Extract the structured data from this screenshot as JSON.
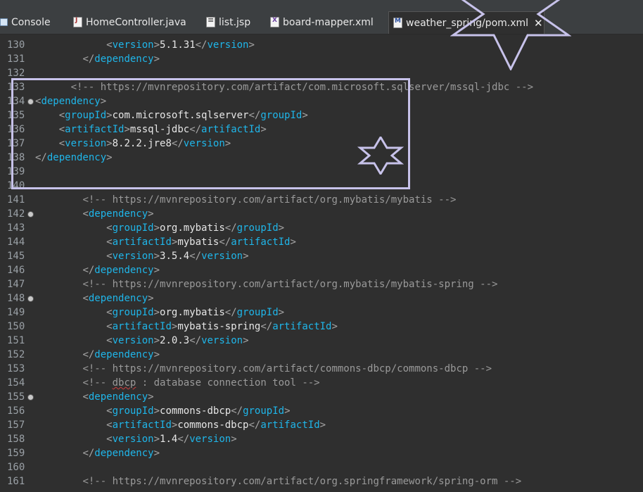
{
  "tabs": [
    {
      "label": "Console",
      "icon": "console-icon",
      "active": false
    },
    {
      "label": "HomeController.java",
      "icon": "java-file-icon",
      "active": false
    },
    {
      "label": "list.jsp",
      "icon": "jsp-file-icon",
      "active": false
    },
    {
      "label": "board-mapper.xml",
      "icon": "xml-file-icon",
      "active": false
    },
    {
      "label": "weather_spring/pom.xml",
      "icon": "maven-pom-icon",
      "active": true,
      "close": "✕"
    }
  ],
  "editor": {
    "lines": [
      {
        "num": "130",
        "indent": "            ",
        "content": [
          [
            "br",
            "<"
          ],
          [
            "tag",
            "version"
          ],
          [
            "br",
            ">"
          ],
          [
            "text",
            "5.1.31"
          ],
          [
            "br",
            "</"
          ],
          [
            "tag",
            "version"
          ],
          [
            "br",
            ">"
          ]
        ]
      },
      {
        "num": "131",
        "indent": "        ",
        "content": [
          [
            "br",
            "</"
          ],
          [
            "tag",
            "dependency"
          ],
          [
            "br",
            ">"
          ]
        ]
      },
      {
        "num": "132",
        "indent": "",
        "content": []
      },
      {
        "num": "133",
        "indent": "      ",
        "content": [
          [
            "comment",
            "<!-- https://mvnrepository.com/artifact/com.microsoft.sqlserver/mssql-jdbc -->"
          ]
        ]
      },
      {
        "num": "134",
        "indent": "",
        "fold": true,
        "content": [
          [
            "br",
            "<"
          ],
          [
            "tag",
            "dependency"
          ],
          [
            "br",
            ">"
          ]
        ]
      },
      {
        "num": "135",
        "indent": "    ",
        "content": [
          [
            "br",
            "<"
          ],
          [
            "tag",
            "groupId"
          ],
          [
            "br",
            ">"
          ],
          [
            "text",
            "com.microsoft.sqlserver"
          ],
          [
            "br",
            "</"
          ],
          [
            "tag",
            "groupId"
          ],
          [
            "br",
            ">"
          ]
        ]
      },
      {
        "num": "136",
        "indent": "    ",
        "content": [
          [
            "br",
            "<"
          ],
          [
            "tag",
            "artifactId"
          ],
          [
            "br",
            ">"
          ],
          [
            "text",
            "mssql-jdbc"
          ],
          [
            "br",
            "</"
          ],
          [
            "tag",
            "artifactId"
          ],
          [
            "br",
            ">"
          ]
        ]
      },
      {
        "num": "137",
        "indent": "    ",
        "content": [
          [
            "br",
            "<"
          ],
          [
            "tag",
            "version"
          ],
          [
            "br",
            ">"
          ],
          [
            "text",
            "8.2.2.jre8"
          ],
          [
            "br",
            "</"
          ],
          [
            "tag",
            "version"
          ],
          [
            "br",
            ">"
          ]
        ]
      },
      {
        "num": "138",
        "indent": "",
        "content": [
          [
            "br",
            "</"
          ],
          [
            "tag",
            "dependency"
          ],
          [
            "br",
            ">"
          ]
        ]
      },
      {
        "num": "139",
        "indent": "",
        "content": []
      },
      {
        "num": "140",
        "indent": "",
        "content": []
      },
      {
        "num": "141",
        "indent": "        ",
        "content": [
          [
            "comment",
            "<!-- https://mvnrepository.com/artifact/org.mybatis/mybatis -->"
          ]
        ]
      },
      {
        "num": "142",
        "indent": "        ",
        "fold": true,
        "content": [
          [
            "br",
            "<"
          ],
          [
            "tag",
            "dependency"
          ],
          [
            "br",
            ">"
          ]
        ]
      },
      {
        "num": "143",
        "indent": "            ",
        "content": [
          [
            "br",
            "<"
          ],
          [
            "tag",
            "groupId"
          ],
          [
            "br",
            ">"
          ],
          [
            "text",
            "org.mybatis"
          ],
          [
            "br",
            "</"
          ],
          [
            "tag",
            "groupId"
          ],
          [
            "br",
            ">"
          ]
        ]
      },
      {
        "num": "144",
        "indent": "            ",
        "content": [
          [
            "br",
            "<"
          ],
          [
            "tag",
            "artifactId"
          ],
          [
            "br",
            ">"
          ],
          [
            "text",
            "mybatis"
          ],
          [
            "br",
            "</"
          ],
          [
            "tag",
            "artifactId"
          ],
          [
            "br",
            ">"
          ]
        ]
      },
      {
        "num": "145",
        "indent": "            ",
        "content": [
          [
            "br",
            "<"
          ],
          [
            "tag",
            "version"
          ],
          [
            "br",
            ">"
          ],
          [
            "text",
            "3.5.4"
          ],
          [
            "br",
            "</"
          ],
          [
            "tag",
            "version"
          ],
          [
            "br",
            ">"
          ]
        ]
      },
      {
        "num": "146",
        "indent": "        ",
        "content": [
          [
            "br",
            "</"
          ],
          [
            "tag",
            "dependency"
          ],
          [
            "br",
            ">"
          ]
        ]
      },
      {
        "num": "147",
        "indent": "        ",
        "content": [
          [
            "comment",
            "<!-- https://mvnrepository.com/artifact/org.mybatis/mybatis-spring -->"
          ]
        ]
      },
      {
        "num": "148",
        "indent": "        ",
        "fold": true,
        "content": [
          [
            "br",
            "<"
          ],
          [
            "tag",
            "dependency"
          ],
          [
            "br",
            ">"
          ]
        ]
      },
      {
        "num": "149",
        "indent": "            ",
        "content": [
          [
            "br",
            "<"
          ],
          [
            "tag",
            "groupId"
          ],
          [
            "br",
            ">"
          ],
          [
            "text",
            "org.mybatis"
          ],
          [
            "br",
            "</"
          ],
          [
            "tag",
            "groupId"
          ],
          [
            "br",
            ">"
          ]
        ]
      },
      {
        "num": "150",
        "indent": "            ",
        "content": [
          [
            "br",
            "<"
          ],
          [
            "tag",
            "artifactId"
          ],
          [
            "br",
            ">"
          ],
          [
            "text",
            "mybatis-spring"
          ],
          [
            "br",
            "</"
          ],
          [
            "tag",
            "artifactId"
          ],
          [
            "br",
            ">"
          ]
        ]
      },
      {
        "num": "151",
        "indent": "            ",
        "content": [
          [
            "br",
            "<"
          ],
          [
            "tag",
            "version"
          ],
          [
            "br",
            ">"
          ],
          [
            "text",
            "2.0.3"
          ],
          [
            "br",
            "</"
          ],
          [
            "tag",
            "version"
          ],
          [
            "br",
            ">"
          ]
        ]
      },
      {
        "num": "152",
        "indent": "        ",
        "content": [
          [
            "br",
            "</"
          ],
          [
            "tag",
            "dependency"
          ],
          [
            "br",
            ">"
          ]
        ]
      },
      {
        "num": "153",
        "indent": "        ",
        "content": [
          [
            "comment",
            "<!-- https://mvnrepository.com/artifact/commons-dbcp/commons-dbcp -->"
          ]
        ]
      },
      {
        "num": "154",
        "indent": "        ",
        "content": [
          [
            "comment",
            "<!-- "
          ],
          [
            "squig",
            "dbcp"
          ],
          [
            "comment",
            " : database connection tool -->"
          ]
        ]
      },
      {
        "num": "155",
        "indent": "        ",
        "fold": true,
        "content": [
          [
            "br",
            "<"
          ],
          [
            "tag",
            "dependency"
          ],
          [
            "br",
            ">"
          ]
        ]
      },
      {
        "num": "156",
        "indent": "            ",
        "content": [
          [
            "br",
            "<"
          ],
          [
            "tag",
            "groupId"
          ],
          [
            "br",
            ">"
          ],
          [
            "text",
            "commons-dbcp"
          ],
          [
            "br",
            "</"
          ],
          [
            "tag",
            "groupId"
          ],
          [
            "br",
            ">"
          ]
        ]
      },
      {
        "num": "157",
        "indent": "            ",
        "content": [
          [
            "br",
            "<"
          ],
          [
            "tag",
            "artifactId"
          ],
          [
            "br",
            ">"
          ],
          [
            "text",
            "commons-dbcp"
          ],
          [
            "br",
            "</"
          ],
          [
            "tag",
            "artifactId"
          ],
          [
            "br",
            ">"
          ]
        ]
      },
      {
        "num": "158",
        "indent": "            ",
        "content": [
          [
            "br",
            "<"
          ],
          [
            "tag",
            "version"
          ],
          [
            "br",
            ">"
          ],
          [
            "text",
            "1.4"
          ],
          [
            "br",
            "</"
          ],
          [
            "tag",
            "version"
          ],
          [
            "br",
            ">"
          ]
        ]
      },
      {
        "num": "159",
        "indent": "        ",
        "content": [
          [
            "br",
            "</"
          ],
          [
            "tag",
            "dependency"
          ],
          [
            "br",
            ">"
          ]
        ]
      },
      {
        "num": "160",
        "indent": "",
        "content": []
      },
      {
        "num": "161",
        "indent": "        ",
        "content": [
          [
            "comment",
            "<!-- https://mvnrepository.com/artifact/org.springframework/spring-orm -->"
          ]
        ]
      }
    ]
  },
  "colors": {
    "background": "#2f2f2f",
    "tag": "#1fb6ea",
    "comment": "#9a9a9a",
    "text": "#e6e6e6",
    "annotation": "#c7c2ea"
  }
}
